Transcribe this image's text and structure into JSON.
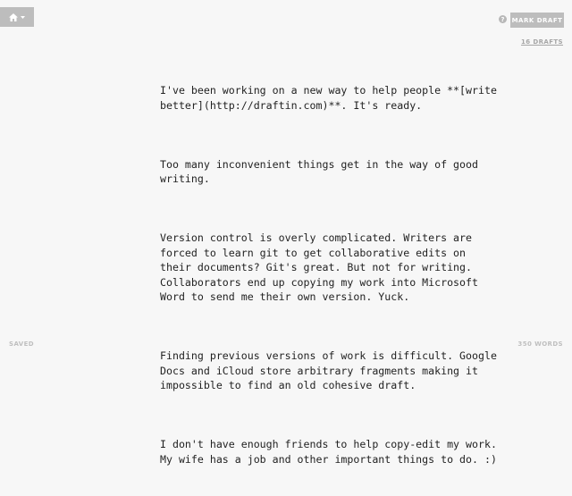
{
  "toolbar": {
    "home_icon": "home-icon",
    "dropdown_icon": "caret-down-icon",
    "help_icon": "question-circle-icon",
    "help_label": "?",
    "mark_draft_label": "MARK DRAFT",
    "drafts_link_label": "16 DRAFTS"
  },
  "document": {
    "paragraphs": [
      "I've been working on a new way to help people **[write better](http://draftin.com)**. It's ready.",
      "Too many inconvenient things get in the way of good writing.",
      "Version control is overly complicated. Writers are forced to learn git to get collaborative edits on their documents? Git's great. But not for writing. Collaborators end up copying my work into Microsoft Word to send me their own version. Yuck.",
      "Finding previous versions of work is difficult. Google Docs and iCloud store arbitrary fragments making it impossible to find an old cohesive draft.",
      "I don't have enough friends to help copy-edit my work. My wife has a job and other important things to do. :)"
    ]
  },
  "status": {
    "save_state": "SAVED",
    "word_count": "350 WORDS"
  },
  "colors": {
    "background": "#f7f7f7",
    "button_gray": "#bdbdbd",
    "text": "#222222",
    "muted": "#bfbfbf"
  }
}
